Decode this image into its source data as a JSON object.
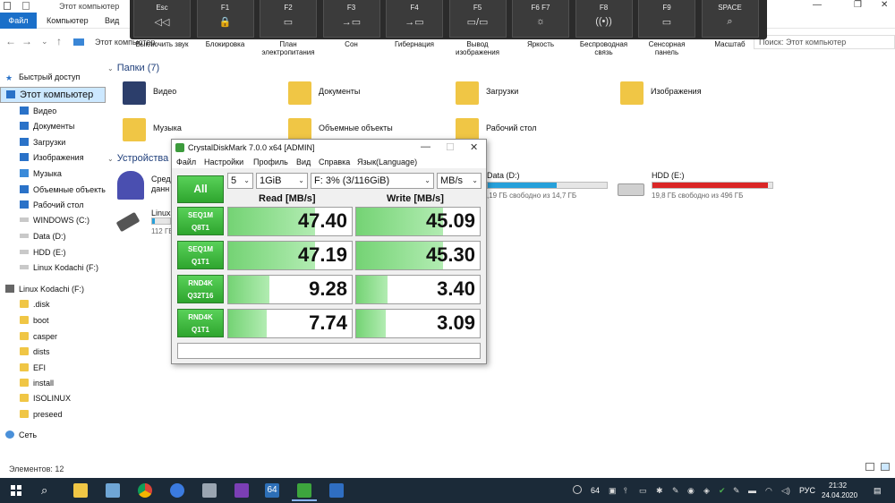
{
  "explorer": {
    "window_title": "Этот компьютер",
    "ribbon": {
      "file": "Файл",
      "computer": "Компьютер",
      "view": "Вид"
    },
    "address": {
      "path": "Этот компьютер",
      "search_placeholder": "Поиск: Этот компьютер"
    },
    "nav_pane": {
      "items": [
        {
          "label": "Быстрый доступ"
        },
        {
          "label": "Этот компьютер"
        },
        {
          "label": "Видео"
        },
        {
          "label": "Документы"
        },
        {
          "label": "Загрузки"
        },
        {
          "label": "Изображения"
        },
        {
          "label": "Музыка"
        },
        {
          "label": "Объемные объекты"
        },
        {
          "label": "Рабочий стол"
        },
        {
          "label": "WINDOWS (C:)"
        },
        {
          "label": "Data (D:)"
        },
        {
          "label": "HDD (E:)"
        },
        {
          "label": "Linux Kodachi (F:)"
        },
        {
          "label": "Linux Kodachi (F:)"
        },
        {
          "label": ".disk"
        },
        {
          "label": "boot"
        },
        {
          "label": "casper"
        },
        {
          "label": "dists"
        },
        {
          "label": "EFI"
        },
        {
          "label": "install"
        },
        {
          "label": "ISOLINUX"
        },
        {
          "label": "preseed"
        },
        {
          "label": "Сеть"
        }
      ]
    },
    "folders_group": "Папки (7)",
    "folders": [
      {
        "name": "Видео"
      },
      {
        "name": "Документы"
      },
      {
        "name": "Загрузки"
      },
      {
        "name": "Изображения"
      },
      {
        "name": "Музыка"
      },
      {
        "name": "Объемные объекты"
      },
      {
        "name": "Рабочий стол"
      }
    ],
    "devices_group": "Устройства",
    "device_partial": {
      "name": "Сред",
      "name2": "данн"
    },
    "drives": [
      {
        "name": "Linux",
        "sub": "112 ГБ",
        "fill": 0.15,
        "color": "#26a0da"
      },
      {
        "name": "Data (D:)",
        "sub": ",19 ГБ свободно из 14,7 ГБ",
        "fill": 0.58,
        "color": "#26a0da"
      },
      {
        "name": "HDD (E:)",
        "sub": "19,8 ГБ свободно из 496 ГБ",
        "fill": 0.96,
        "color": "#da2626"
      }
    ],
    "status": "Элементов: 12"
  },
  "key_overlay": {
    "keys": [
      {
        "key": "Esc",
        "icon": "◁◁",
        "label1": "Выключить звук",
        "label2": ""
      },
      {
        "key": "F1",
        "icon": "🔒",
        "label1": "Блокировка",
        "label2": ""
      },
      {
        "key": "F2",
        "icon": "▭",
        "label1": "План",
        "label2": "электропитания"
      },
      {
        "key": "F3",
        "icon": "→▭",
        "label1": "Сон",
        "label2": ""
      },
      {
        "key": "F4",
        "icon": "→▭",
        "label1": "Гибернация",
        "label2": ""
      },
      {
        "key": "F5",
        "icon": "▭/▭",
        "label1": "Вывод",
        "label2": "изображения"
      },
      {
        "key": "F6   F7",
        "icon": "☼",
        "label1": "Яркость",
        "label2": ""
      },
      {
        "key": "F8",
        "icon": "((•))",
        "label1": "Беспроводная",
        "label2": "связь"
      },
      {
        "key": "F9",
        "icon": "▭",
        "label1": "Сенсорная",
        "label2": "панель"
      },
      {
        "key": "SPACE",
        "icon": "⌕",
        "label1": "Масштаб",
        "label2": ""
      }
    ]
  },
  "cdm": {
    "title": "CrystalDiskMark 7.0.0 x64 [ADMIN]",
    "menu": [
      "Файл",
      "Настройки",
      "Профиль",
      "Вид",
      "Справка",
      "Язык(Language)"
    ],
    "all_button": "All",
    "count": "5",
    "size": "1GiB",
    "drive": "F: 3% (3/116GiB)",
    "unit": "MB/s",
    "read_header": "Read [MB/s]",
    "write_header": "Write [MB/s]",
    "rows": [
      {
        "label1": "SEQ1M",
        "label2": "Q8T1",
        "read": "47.40",
        "write": "45.09",
        "read_fill": 0.7,
        "write_fill": 0.7
      },
      {
        "label1": "SEQ1M",
        "label2": "Q1T1",
        "read": "47.19",
        "write": "45.30",
        "read_fill": 0.7,
        "write_fill": 0.7
      },
      {
        "label1": "RND4K",
        "label2": "Q32T16",
        "read": "9.28",
        "write": "3.40",
        "read_fill": 0.33,
        "write_fill": 0.25
      },
      {
        "label1": "RND4K",
        "label2": "Q1T1",
        "read": "7.74",
        "write": "3.09",
        "read_fill": 0.31,
        "write_fill": 0.24
      }
    ]
  },
  "taskbar": {
    "badge": "64",
    "tray_lang": "РУС",
    "time": "21:32",
    "date": "24.04.2020"
  }
}
